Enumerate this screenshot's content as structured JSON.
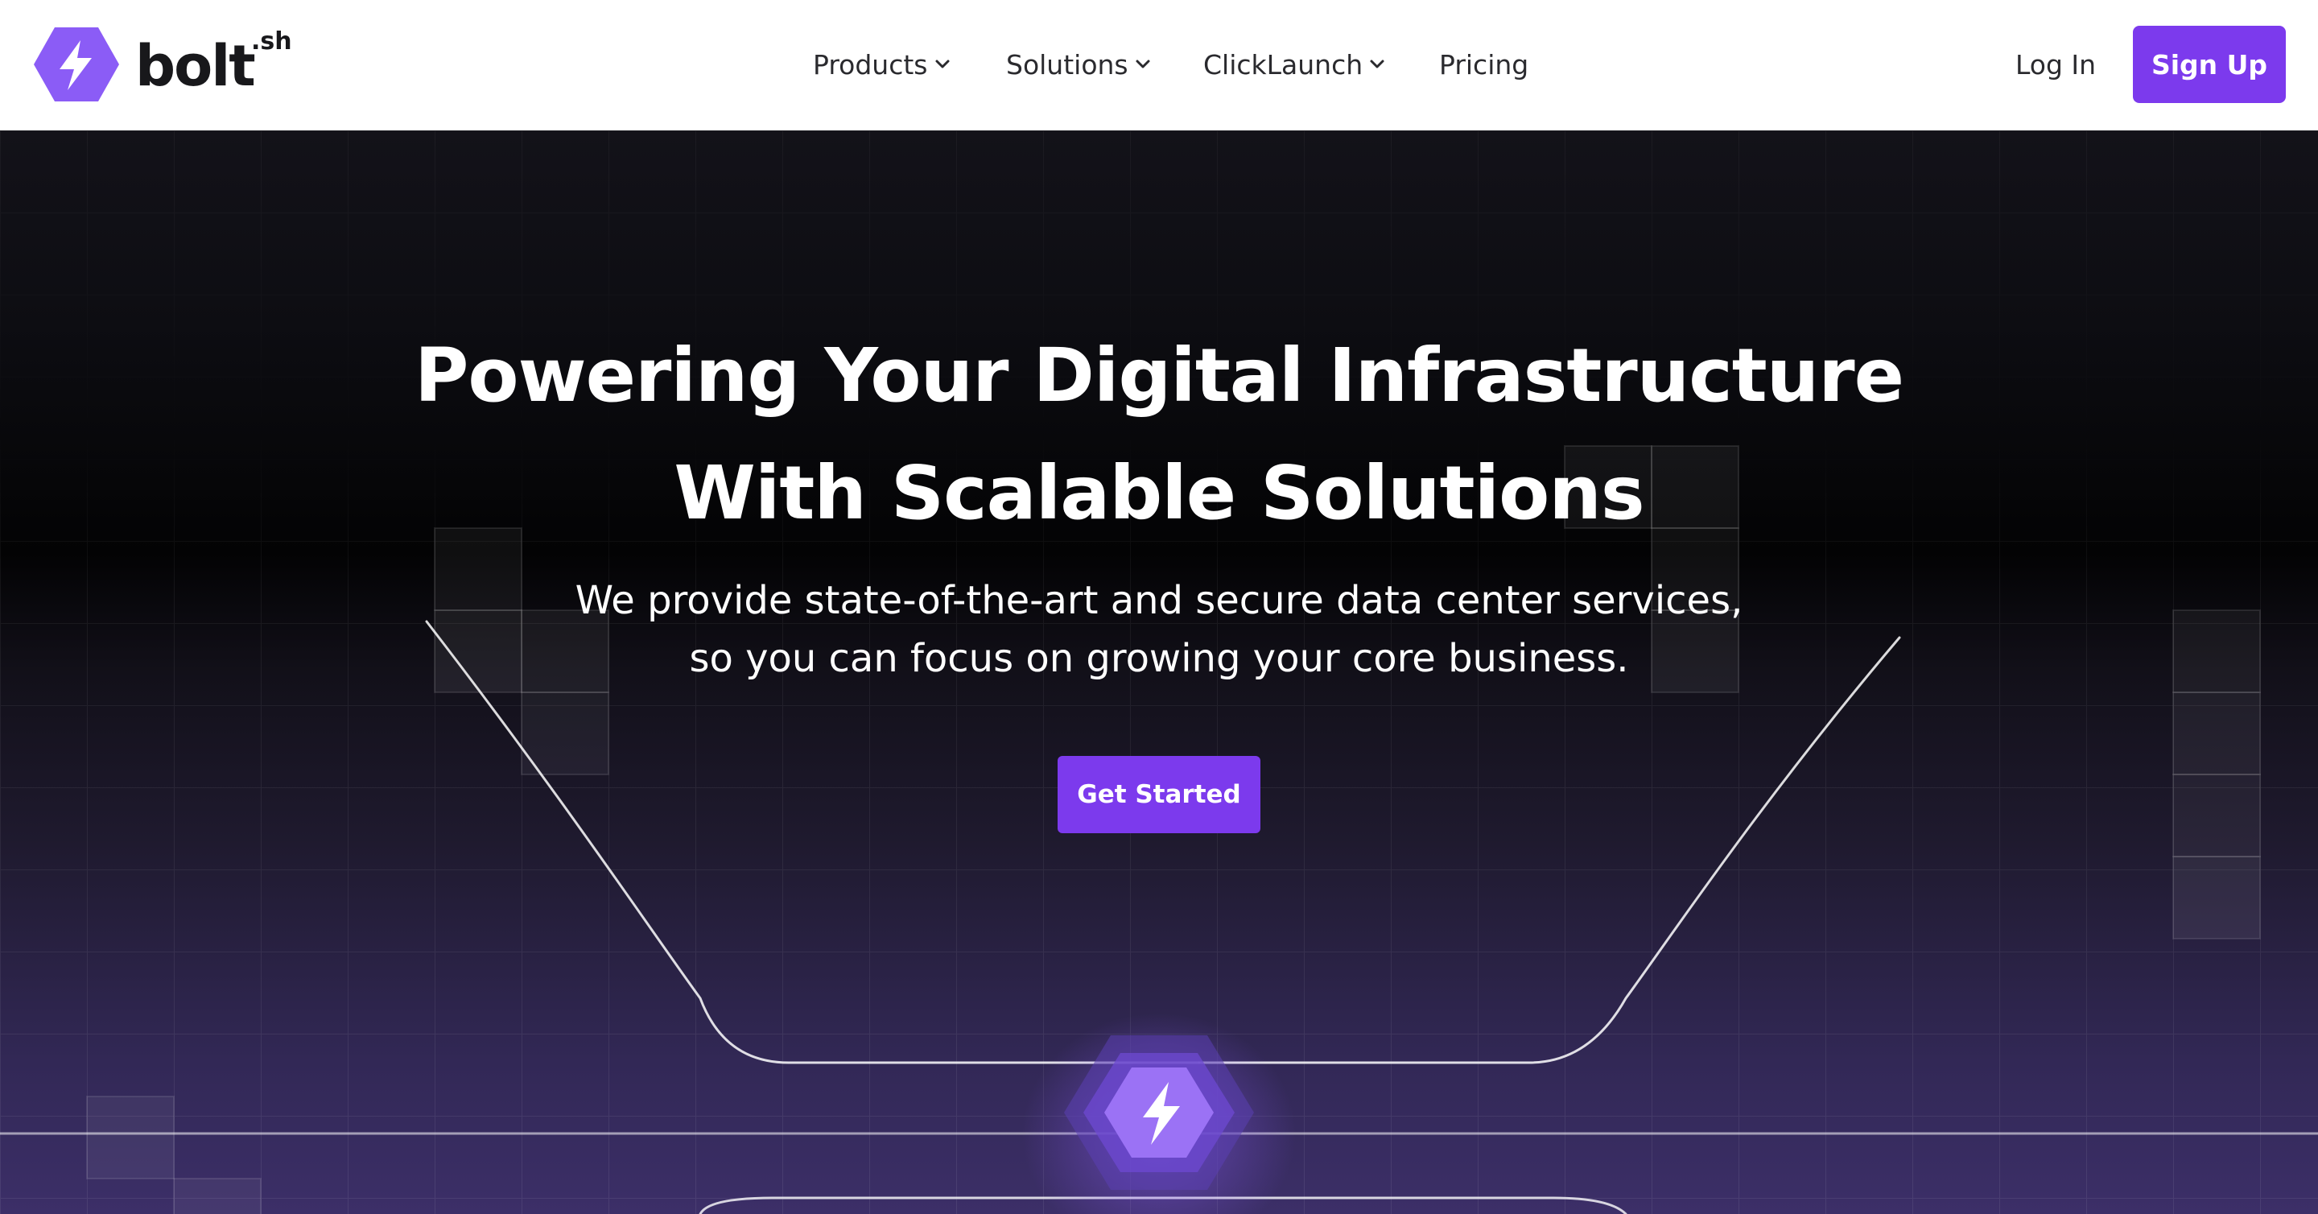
{
  "brand": {
    "name": "bolt",
    "superscript": ".sh",
    "logo_icon": "hexagon-lightning-bolt-icon",
    "accent_color": "#7c3aed"
  },
  "nav": {
    "items": [
      {
        "label": "Products",
        "has_dropdown": true
      },
      {
        "label": "Solutions",
        "has_dropdown": true
      },
      {
        "label": "ClickLaunch",
        "has_dropdown": true
      },
      {
        "label": "Pricing",
        "has_dropdown": false
      }
    ],
    "login_label": "Log In",
    "signup_label": "Sign Up"
  },
  "hero": {
    "title_line1": "Powering Your Digital Infrastructure",
    "title_line2": "With Scalable Solutions",
    "subtitle_line1": "We provide state-of-the-art and secure data center services,",
    "subtitle_line2": "so you can focus on growing your core business.",
    "cta_label": "Get Started",
    "background_top": "#131219",
    "background_bottom": "#3c2f68"
  }
}
